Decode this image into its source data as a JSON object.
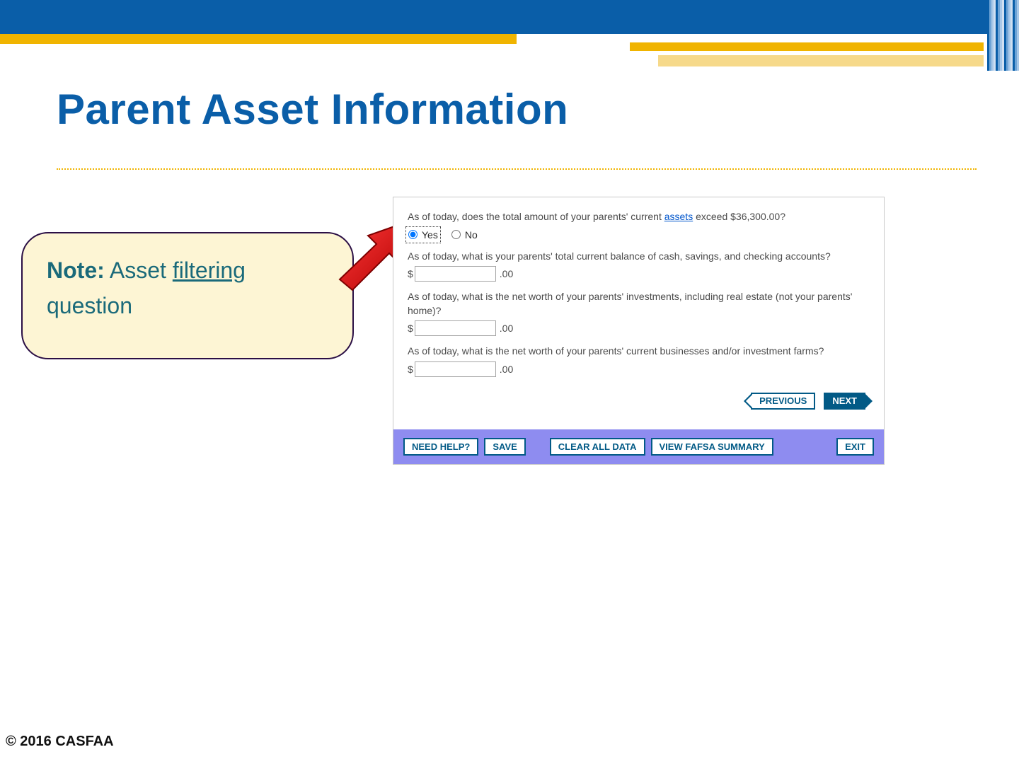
{
  "title": "Parent Asset Information",
  "callout": {
    "note_label": "Note:",
    "text_before_underline": " Asset ",
    "underlined_word": "filtering",
    "text_after_underline": " question"
  },
  "form": {
    "q1": {
      "pre": "As of today, does the total amount of your parents' current ",
      "link": "assets",
      "post": " exceed $36,300.00?",
      "yes": "Yes",
      "no": "No"
    },
    "q2": {
      "text": "As of today, what is your parents' total current balance of cash, savings, and checking accounts?",
      "dollar": "$",
      "cents": ".00"
    },
    "q3": {
      "text": "As of today, what is the net worth of your parents' investments, including real estate (not your parents' home)?",
      "dollar": "$",
      "cents": ".00"
    },
    "q4": {
      "text": "As of today, what is the net worth of your parents' current businesses and/or investment farms?",
      "dollar": "$",
      "cents": ".00"
    },
    "nav": {
      "previous": "PREVIOUS",
      "next": "NEXT"
    },
    "bottom": {
      "need_help": "NEED HELP?",
      "save": "SAVE",
      "clear_all": "CLEAR ALL DATA",
      "view_summary": "VIEW FAFSA SUMMARY",
      "exit": "EXIT"
    }
  },
  "copyright": "© 2016 CASFAA"
}
